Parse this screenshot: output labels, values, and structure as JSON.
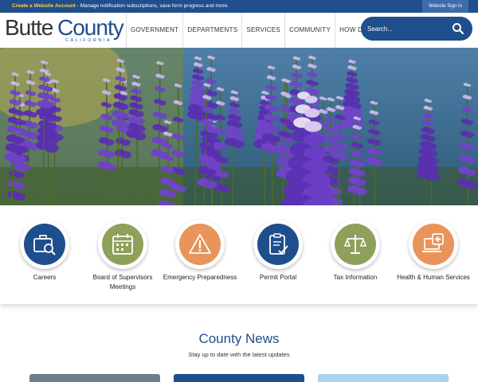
{
  "topbar": {
    "account_link": "Create a Website Account",
    "account_message": " - Manage notification subscriptions, save form progress and more.",
    "signin_label": "Website Sign In"
  },
  "logo": {
    "word1": "Butte",
    "word2": "County",
    "subtitle": "CALIFORNIA"
  },
  "nav": {
    "items": [
      "GOVERNMENT",
      "DEPARTMENTS",
      "SERVICES",
      "COMMUNITY",
      "HOW DO I..."
    ]
  },
  "search": {
    "placeholder": "Search...",
    "icon": "search-icon"
  },
  "hero": {
    "image": "lupine-flowers-by-water"
  },
  "quick_links": [
    {
      "label": "Careers",
      "icon": "briefcase-search-icon",
      "color": "#1f4e8c"
    },
    {
      "label": "Board of Supervisors Meetings",
      "icon": "calendar-icon",
      "color": "#8ea05a"
    },
    {
      "label": "Emergency Preparedness",
      "icon": "warning-icon",
      "color": "#e8945a"
    },
    {
      "label": "Permit Portal",
      "icon": "clipboard-check-icon",
      "color": "#1f4e8c"
    },
    {
      "label": "Tax Information",
      "icon": "scales-icon",
      "color": "#8ea05a"
    },
    {
      "label": "Health & Human Services",
      "icon": "health-laptop-icon",
      "color": "#e8945a"
    }
  ],
  "news": {
    "title": "County News",
    "subtitle": "Stay up to date with the latest updates"
  },
  "colors": {
    "brand": "#1f4e8c",
    "accent_gold": "#ffd24a",
    "green": "#8ea05a",
    "orange": "#e8945a"
  }
}
